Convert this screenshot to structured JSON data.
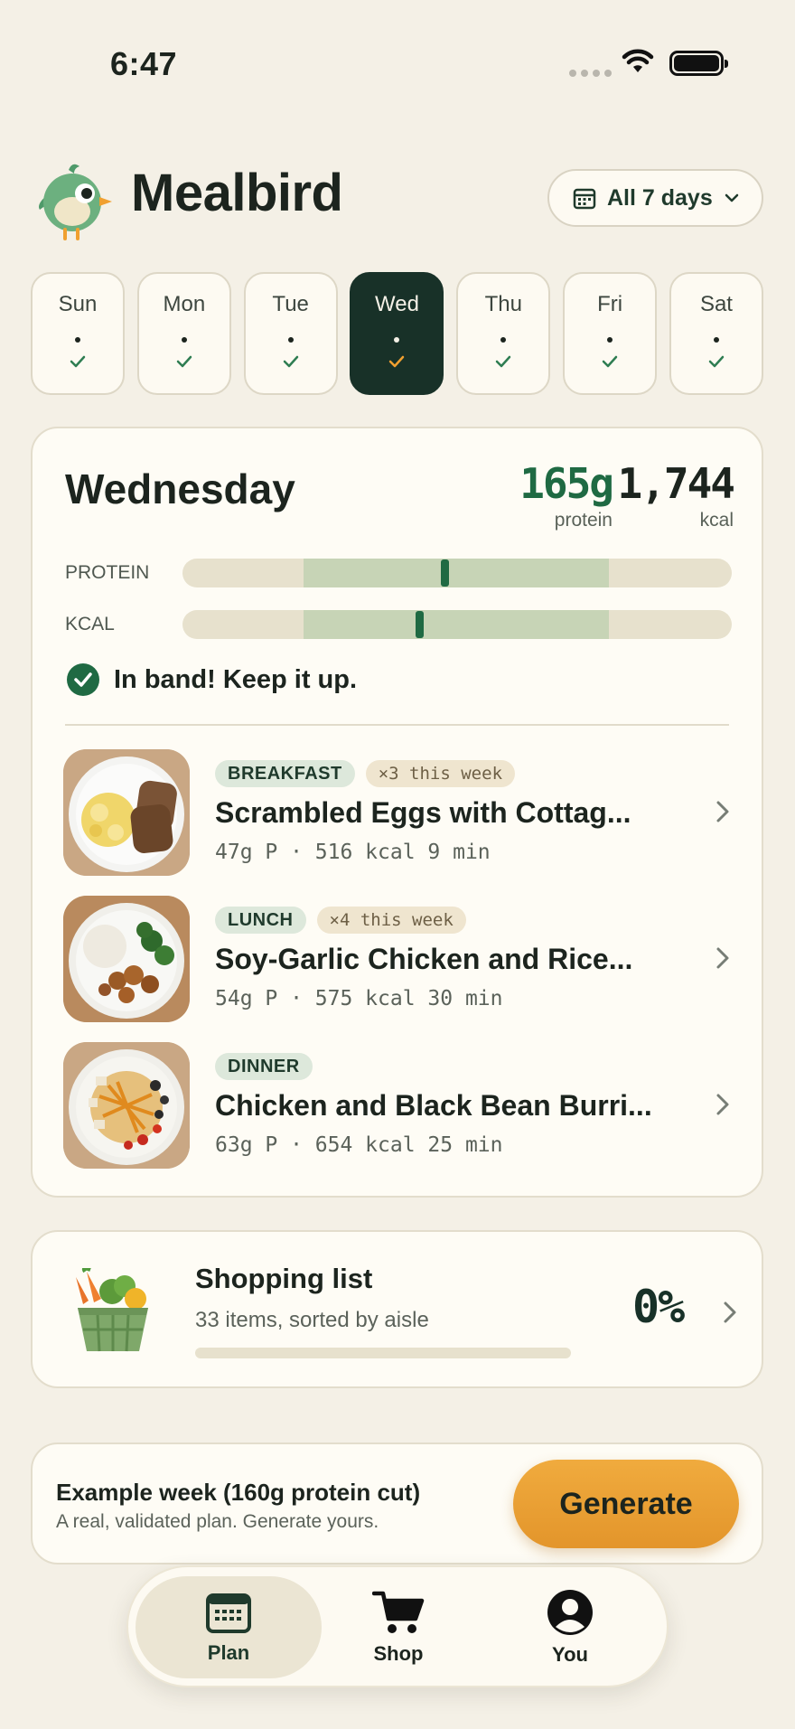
{
  "status_bar": {
    "time": "6:47"
  },
  "header": {
    "app_name": "Mealbird",
    "days_filter_label": "All 7 days"
  },
  "days": [
    {
      "label": "Sun",
      "selected": false
    },
    {
      "label": "Mon",
      "selected": false
    },
    {
      "label": "Tue",
      "selected": false
    },
    {
      "label": "Wed",
      "selected": true
    },
    {
      "label": "Thu",
      "selected": false
    },
    {
      "label": "Fri",
      "selected": false
    },
    {
      "label": "Sat",
      "selected": false
    }
  ],
  "summary": {
    "day_name": "Wednesday",
    "protein_value": "165g",
    "protein_unit": "protein",
    "kcal_value": "1,744",
    "kcal_unit": "kcal",
    "protein_bar_label": "PROTEIN",
    "kcal_bar_label": "KCAL",
    "status_text": "In band! Keep it up."
  },
  "meals": [
    {
      "kind": "BREAKFAST",
      "count": "×3 this week",
      "title": "Scrambled Eggs with Cottag...",
      "meta": "47g P · 516 kcal 9 min"
    },
    {
      "kind": "LUNCH",
      "count": "×4 this week",
      "title": "Soy-Garlic Chicken and Rice...",
      "meta": "54g P · 575 kcal 30 min"
    },
    {
      "kind": "DINNER",
      "count": "",
      "title": "Chicken and Black Bean Burri...",
      "meta": "63g P · 654 kcal 25 min"
    }
  ],
  "shopping": {
    "title": "Shopping list",
    "subtitle": "33 items, sorted by aisle",
    "percent": "0%",
    "progress": 0
  },
  "example": {
    "title": "Example week (160g protein cut)",
    "subtitle": "A real, validated plan. Generate yours.",
    "button": "Generate"
  },
  "nav": {
    "plan": "Plan",
    "shop": "Shop",
    "you": "You"
  },
  "colors": {
    "background": "#f4f0e6",
    "accent_dark_green": "#183128",
    "accent_green": "#1f6a43",
    "accent_orange": "#e3952b"
  }
}
